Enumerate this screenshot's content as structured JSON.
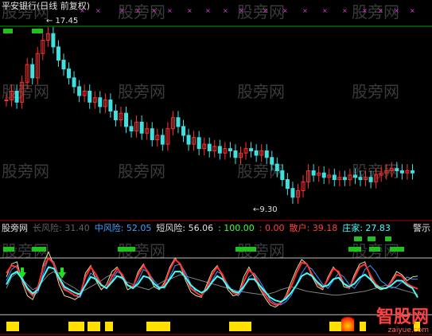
{
  "title": "平安银行(日线 前复权)",
  "price_labels": {
    "high": "17.45",
    "low": "9.30"
  },
  "indicator": {
    "items": [
      {
        "label": "股旁网",
        "color": "#e0e0e0"
      },
      {
        "label": "长风险: 31.40",
        "color": "#606060"
      },
      {
        "label": "中风险: 52.05",
        "color": "#40a0ff"
      },
      {
        "label": "短风险: 56.06",
        "color": "#e0e0e0"
      },
      {
        "label": ": 100.00",
        "color": "#40ff40"
      },
      {
        "label": ": 0.00",
        "color": "#ff4040"
      },
      {
        "label": "散户: 39.18",
        "color": "#ff4040"
      },
      {
        "label": "庄家: 27.83",
        "color": "#40ffff"
      }
    ],
    "right_label": "警示"
  },
  "watermark": "股旁网",
  "logo": {
    "brand": "智股网",
    "url": "zaiyue.com"
  },
  "colors": {
    "up": "#ff3030",
    "down": "#40e0e0",
    "mid": "#4090ff",
    "bg": "#000000"
  },
  "chart_data": [
    {
      "type": "candlestick",
      "title": "平安银行(日线 前复权)",
      "annotations": [
        {
          "text": "17.45",
          "value": 17.45
        },
        {
          "text": "9.30",
          "value": 9.3
        }
      ],
      "ylim": [
        9.0,
        18.0
      ],
      "close": [
        14.2,
        14.6,
        14.1,
        15.0,
        15.8,
        15.2,
        16.3,
        16.9,
        17.2,
        16.6,
        16.0,
        15.6,
        15.2,
        14.8,
        14.4,
        14.6,
        14.1,
        14.3,
        13.9,
        14.2,
        13.7,
        13.3,
        13.6,
        13.0,
        12.8,
        13.2,
        12.7,
        12.9,
        12.4,
        12.6,
        12.2,
        12.9,
        13.4,
        13.0,
        12.6,
        12.2,
        12.5,
        12.0,
        12.2,
        11.9,
        12.1,
        11.8,
        12.0,
        11.9,
        11.6,
        11.8,
        12.0,
        11.9,
        11.7,
        11.9,
        11.6,
        11.3,
        11.0,
        10.6,
        10.2,
        9.8,
        10.1,
        10.5,
        11.0,
        10.8,
        10.9,
        10.7,
        10.8,
        10.6,
        10.7,
        10.6,
        10.8,
        10.7,
        10.6,
        10.7,
        10.5,
        10.8,
        10.9,
        11.0,
        11.1,
        11.0,
        10.9,
        11.0,
        10.9
      ]
    },
    {
      "type": "line",
      "series": [
        {
          "name": "长风险",
          "values": [
            40,
            55,
            60,
            52,
            45,
            38,
            42,
            50,
            58,
            62,
            55,
            48,
            44,
            40,
            35,
            38,
            42,
            46,
            50,
            55,
            58,
            56,
            52,
            48,
            45,
            42,
            40,
            38,
            42,
            46,
            50,
            52,
            55,
            58,
            56,
            54,
            52,
            50,
            48,
            46,
            44,
            42,
            40,
            38,
            36,
            35,
            34,
            33,
            32,
            31,
            33,
            35,
            38,
            40,
            42,
            40,
            38,
            36,
            35,
            34,
            33,
            32,
            31,
            31,
            32,
            33,
            34,
            35,
            36,
            38,
            40,
            42,
            44,
            42,
            40,
            38,
            36,
            34,
            31.4
          ]
        },
        {
          "name": "中风险",
          "values": [
            50,
            65,
            70,
            55,
            40,
            30,
            35,
            60,
            80,
            75,
            55,
            40,
            35,
            30,
            28,
            45,
            60,
            55,
            45,
            40,
            50,
            62,
            58,
            45,
            40,
            50,
            65,
            60,
            50,
            42,
            40,
            55,
            70,
            72,
            60,
            45,
            35,
            30,
            38,
            50,
            62,
            58,
            45,
            35,
            30,
            40,
            55,
            60,
            50,
            38,
            25,
            20,
            18,
            22,
            30,
            45,
            60,
            70,
            65,
            55,
            45,
            40,
            50,
            60,
            55,
            45,
            40,
            50,
            65,
            70,
            62,
            50,
            45,
            40,
            42,
            48,
            55,
            52,
            52.05
          ]
        },
        {
          "name": "短风险",
          "values": [
            55,
            72,
            75,
            48,
            30,
            25,
            40,
            72,
            88,
            70,
            45,
            30,
            28,
            25,
            30,
            60,
            70,
            50,
            38,
            45,
            62,
            68,
            55,
            38,
            42,
            62,
            72,
            58,
            42,
            38,
            48,
            68,
            80,
            70,
            50,
            35,
            30,
            28,
            45,
            62,
            70,
            55,
            38,
            30,
            32,
            55,
            68,
            55,
            40,
            28,
            18,
            15,
            20,
            30,
            48,
            65,
            78,
            72,
            55,
            42,
            38,
            55,
            68,
            60,
            42,
            40,
            58,
            72,
            75,
            55,
            42,
            38,
            40,
            50,
            62,
            58,
            50,
            55,
            56.06
          ]
        },
        {
          "name": "散户",
          "values": [
            60,
            70,
            68,
            50,
            38,
            30,
            42,
            68,
            80,
            72,
            52,
            38,
            35,
            30,
            32,
            55,
            68,
            58,
            45,
            40,
            55,
            66,
            58,
            44,
            42,
            58,
            70,
            60,
            46,
            40,
            45,
            65,
            78,
            72,
            55,
            40,
            34,
            30,
            40,
            58,
            68,
            58,
            42,
            34,
            32,
            48,
            64,
            58,
            44,
            32,
            22,
            18,
            20,
            28,
            42,
            60,
            74,
            72,
            58,
            46,
            40,
            52,
            66,
            62,
            46,
            40,
            54,
            68,
            72,
            58,
            46,
            40,
            40,
            48,
            58,
            56,
            46,
            42,
            39.18
          ]
        },
        {
          "name": "庄家",
          "values": [
            45,
            58,
            62,
            52,
            40,
            33,
            38,
            55,
            68,
            66,
            54,
            42,
            38,
            34,
            32,
            44,
            55,
            52,
            44,
            40,
            48,
            56,
            54,
            44,
            40,
            46,
            56,
            54,
            46,
            40,
            42,
            52,
            62,
            62,
            54,
            44,
            38,
            34,
            38,
            48,
            56,
            52,
            42,
            36,
            34,
            42,
            52,
            52,
            44,
            36,
            28,
            24,
            22,
            26,
            34,
            44,
            56,
            60,
            56,
            48,
            42,
            44,
            52,
            54,
            46,
            42,
            46,
            54,
            58,
            52,
            44,
            40,
            40,
            44,
            50,
            50,
            44,
            40,
            27.83
          ]
        }
      ]
    }
  ]
}
